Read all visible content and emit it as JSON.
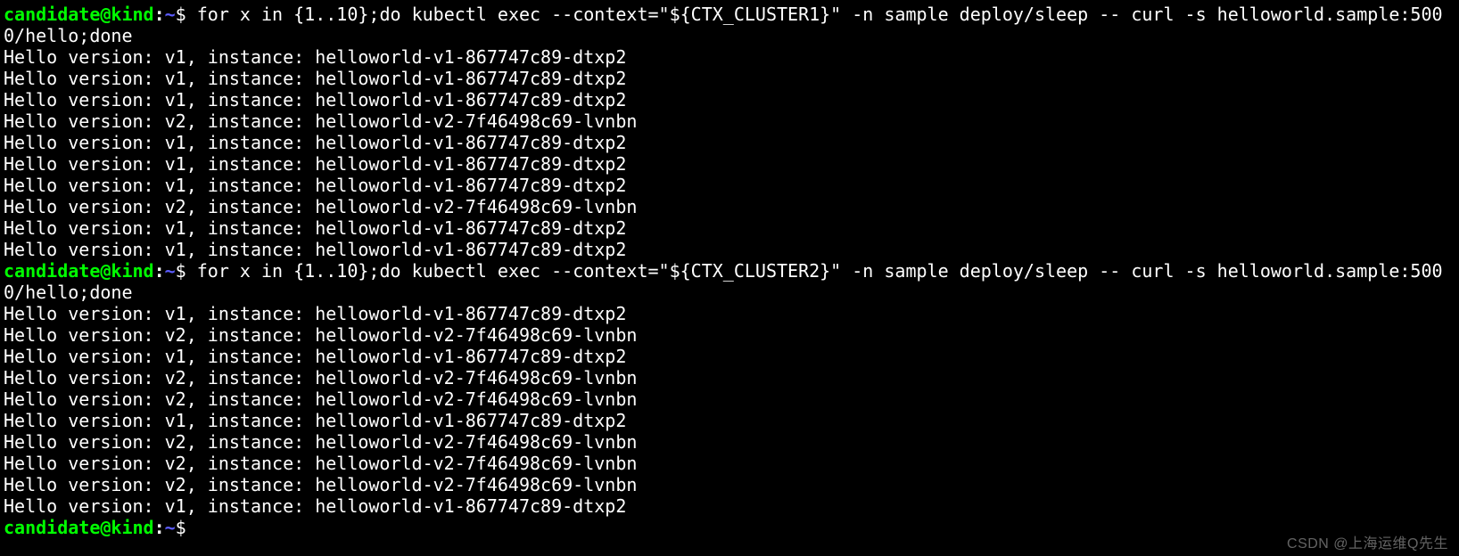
{
  "prompt": {
    "user": "candidate@kind",
    "colon": ":",
    "path": "~",
    "dollar": "$"
  },
  "blocks": [
    {
      "command": "for x in {1..10};do kubectl exec --context=\"${CTX_CLUSTER1}\" -n sample deploy/sleep -- curl -s helloworld.sample:5000/hello;done",
      "output": [
        "Hello version: v1, instance: helloworld-v1-867747c89-dtxp2",
        "Hello version: v1, instance: helloworld-v1-867747c89-dtxp2",
        "Hello version: v1, instance: helloworld-v1-867747c89-dtxp2",
        "Hello version: v2, instance: helloworld-v2-7f46498c69-lvnbn",
        "Hello version: v1, instance: helloworld-v1-867747c89-dtxp2",
        "Hello version: v1, instance: helloworld-v1-867747c89-dtxp2",
        "Hello version: v1, instance: helloworld-v1-867747c89-dtxp2",
        "Hello version: v2, instance: helloworld-v2-7f46498c69-lvnbn",
        "Hello version: v1, instance: helloworld-v1-867747c89-dtxp2",
        "Hello version: v1, instance: helloworld-v1-867747c89-dtxp2"
      ]
    },
    {
      "command": "for x in {1..10};do kubectl exec --context=\"${CTX_CLUSTER2}\" -n sample deploy/sleep -- curl -s helloworld.sample:5000/hello;done",
      "output": [
        "Hello version: v1, instance: helloworld-v1-867747c89-dtxp2",
        "Hello version: v2, instance: helloworld-v2-7f46498c69-lvnbn",
        "Hello version: v1, instance: helloworld-v1-867747c89-dtxp2",
        "Hello version: v2, instance: helloworld-v2-7f46498c69-lvnbn",
        "Hello version: v2, instance: helloworld-v2-7f46498c69-lvnbn",
        "Hello version: v1, instance: helloworld-v1-867747c89-dtxp2",
        "Hello version: v2, instance: helloworld-v2-7f46498c69-lvnbn",
        "Hello version: v2, instance: helloworld-v2-7f46498c69-lvnbn",
        "Hello version: v2, instance: helloworld-v2-7f46498c69-lvnbn",
        "Hello version: v1, instance: helloworld-v1-867747c89-dtxp2"
      ]
    }
  ],
  "trailing_prompt": true,
  "watermark": "CSDN @上海运维Q先生"
}
